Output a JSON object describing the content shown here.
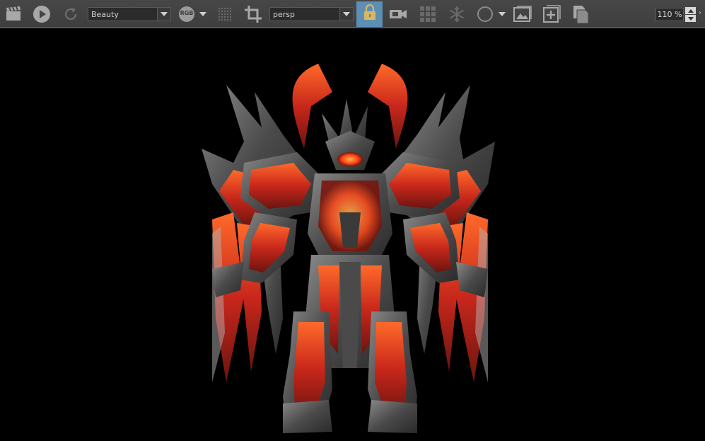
{
  "toolbar": {
    "icons": [
      "clapper-icon",
      "play-icon",
      "refresh-icon",
      "rgb-channel-icon",
      "grid-dots-icon",
      "crop-icon",
      "lock-icon",
      "camera-icon",
      "tiles-icon",
      "snowflake-icon",
      "circle-icon",
      "image-icon",
      "add-image-icon",
      "copy-icon"
    ],
    "render_pass": {
      "label": "Beauty"
    },
    "channel": {
      "label": "RGB"
    },
    "camera": {
      "label": "persp"
    },
    "zoom": {
      "value": "110 %"
    },
    "accent_color": "#5d8fb5"
  },
  "viewport": {
    "background": "#000000",
    "content": "rendered-character"
  }
}
